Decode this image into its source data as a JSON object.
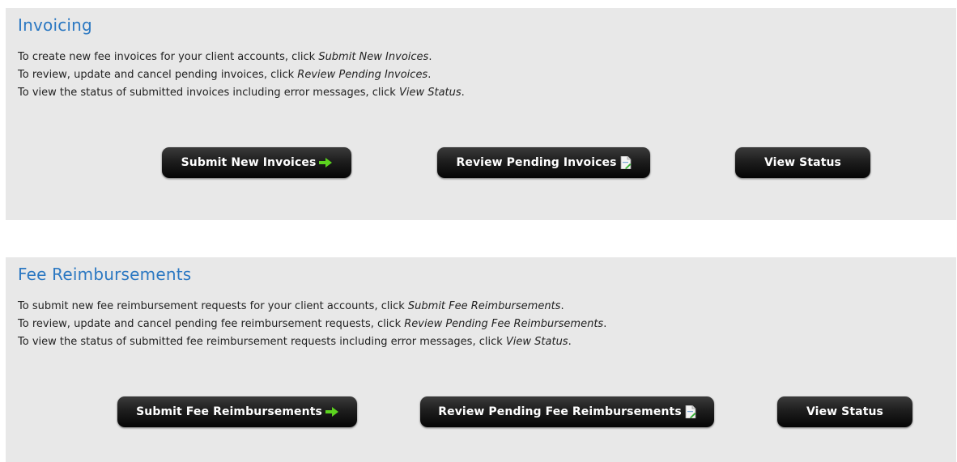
{
  "invoicing": {
    "title": "Invoicing",
    "lines": [
      {
        "text": "To create new fee invoices for your client accounts, click ",
        "em": "Submit New Invoices",
        "end": "."
      },
      {
        "text": "To review, update and cancel pending invoices, click ",
        "em": "Review Pending Invoices",
        "end": "."
      },
      {
        "text": "To view the status of submitted invoices including error messages, click ",
        "em": "View Status",
        "end": "."
      }
    ],
    "buttons": {
      "submit": "Submit New Invoices",
      "review": "Review Pending Invoices",
      "status": "View Status"
    }
  },
  "fees": {
    "title": "Fee Reimbursements",
    "lines": [
      {
        "text": "To submit new fee reimbursement requests for your client accounts, click ",
        "em": "Submit Fee Reimbursements",
        "end": "."
      },
      {
        "text": "To review, update and cancel pending fee reimbursement requests, click ",
        "em": "Review Pending Fee Reimbursements",
        "end": "."
      },
      {
        "text": "To view the status of submitted fee reimbursement requests including error messages, click ",
        "em": "View Status",
        "end": "."
      }
    ],
    "buttons": {
      "submit": "Submit Fee Reimbursements",
      "review": "Review Pending Fee Reimbursements",
      "status": "View Status"
    }
  },
  "icons": {
    "submit": "green-arrow-right-icon",
    "review": "document-edit-icon"
  },
  "colors": {
    "title": "#2b78c2",
    "panel_bg": "#e8e8e8",
    "button_bg": "#1e1e1e",
    "arrow": "#5cd31f"
  }
}
